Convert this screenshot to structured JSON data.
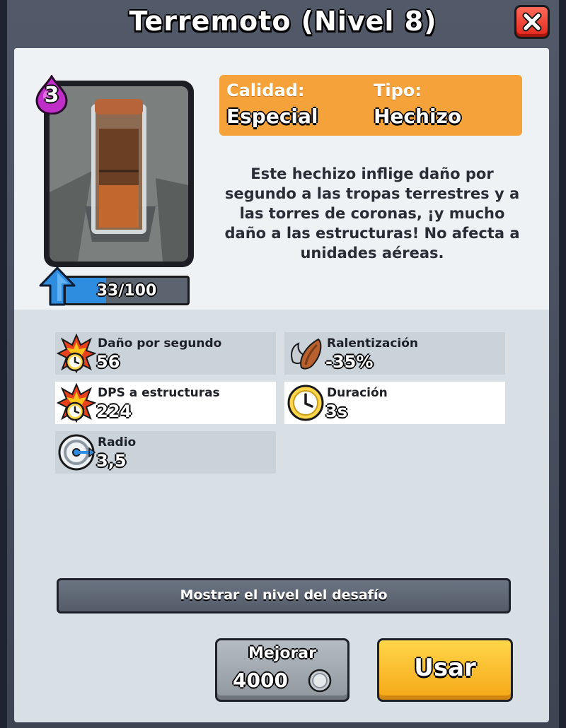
{
  "dialog": {
    "title": "Terremoto (Nivel 8)",
    "close_icon": "close-icon"
  },
  "card": {
    "elixir_cost": "3",
    "image_icon": "earthquake-card-art",
    "progress_text": "33/100",
    "progress_fraction": 0.33
  },
  "info": {
    "quality_label": "Calidad:",
    "quality_value": "Especial",
    "type_label": "Tipo:",
    "type_value": "Hechizo"
  },
  "description": "Este hechizo inflige daño por segundo a las tropas terrestres y a las torres de coronas, ¡y mucho daño a las estructuras! No afecta a unidades aéreas.",
  "stats": [
    {
      "label": "Daño por segundo",
      "value": "56",
      "icon": "damage-per-second-icon"
    },
    {
      "label": "Ralentización",
      "value": "-35%",
      "icon": "slowdown-wing-icon"
    },
    {
      "label": "DPS a estructuras",
      "value": "224",
      "icon": "building-damage-icon"
    },
    {
      "label": "Duración",
      "value": "3s",
      "icon": "clock-icon"
    },
    {
      "label": "Radio",
      "value": "3,5",
      "icon": "radius-icon"
    }
  ],
  "buttons": {
    "challenge_label": "Mostrar el nivel del desafío",
    "upgrade_label": "Mejorar",
    "upgrade_cost": "4000",
    "use_label": "Usar"
  },
  "colors": {
    "info_box": "#f6a23a",
    "use_button": "#f5a716",
    "close_button": "#e1261c",
    "progress_fill": "#2f8de0"
  }
}
